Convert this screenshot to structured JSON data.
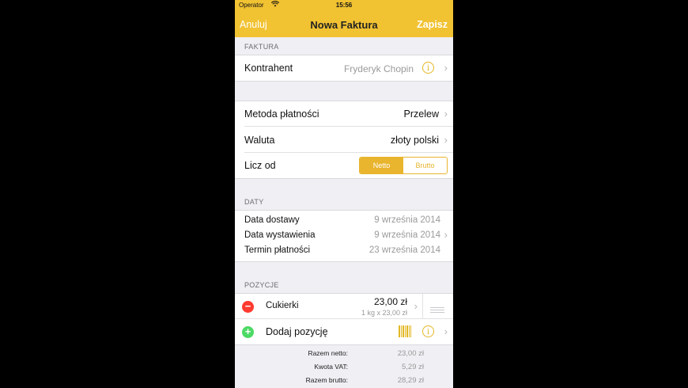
{
  "status": {
    "operator": "Operator",
    "wifi_icon": "wifi-icon",
    "time": "15:56"
  },
  "nav": {
    "cancel": "Anuluj",
    "title": "Nowa Faktura",
    "save": "Zapisz"
  },
  "colors": {
    "accent": "#f1c232",
    "segment": "#e9b52e",
    "remove": "#ff3b30",
    "add": "#4cd964"
  },
  "invoice": {
    "header": "FAKTURA",
    "contractor_label": "Kontrahent",
    "contractor_value": "Fryderyk Chopin",
    "info_glyph": "i"
  },
  "payment": {
    "method_label": "Metoda płatności",
    "method_value": "Przelew",
    "currency_label": "Waluta",
    "currency_value": "złoty polski",
    "calc_label": "Licz od",
    "seg_netto": "Netto",
    "seg_brutto": "Brutto",
    "selected": "Netto"
  },
  "dates": {
    "header": "DATY",
    "items": [
      {
        "label": "Data dostawy",
        "value": "9 września 2014"
      },
      {
        "label": "Data wystawienia",
        "value": "9 września 2014"
      },
      {
        "label": "Termin płatności",
        "value": "23 września 2014"
      }
    ]
  },
  "items": {
    "header": "POZYCJE",
    "list": [
      {
        "name": "Cukierki",
        "price": "23,00 zł",
        "detail": "1 kg x 23,00 zł"
      }
    ],
    "add_label": "Dodaj pozycję",
    "remove_glyph": "−",
    "add_glyph": "+"
  },
  "totals": {
    "net_label": "Razem netto:",
    "net_value": "23,00 zł",
    "vat_label": "Kwota VAT:",
    "vat_value": "5,29 zł",
    "gross_label": "Razem brutto:",
    "gross_value": "28,29 zł"
  }
}
